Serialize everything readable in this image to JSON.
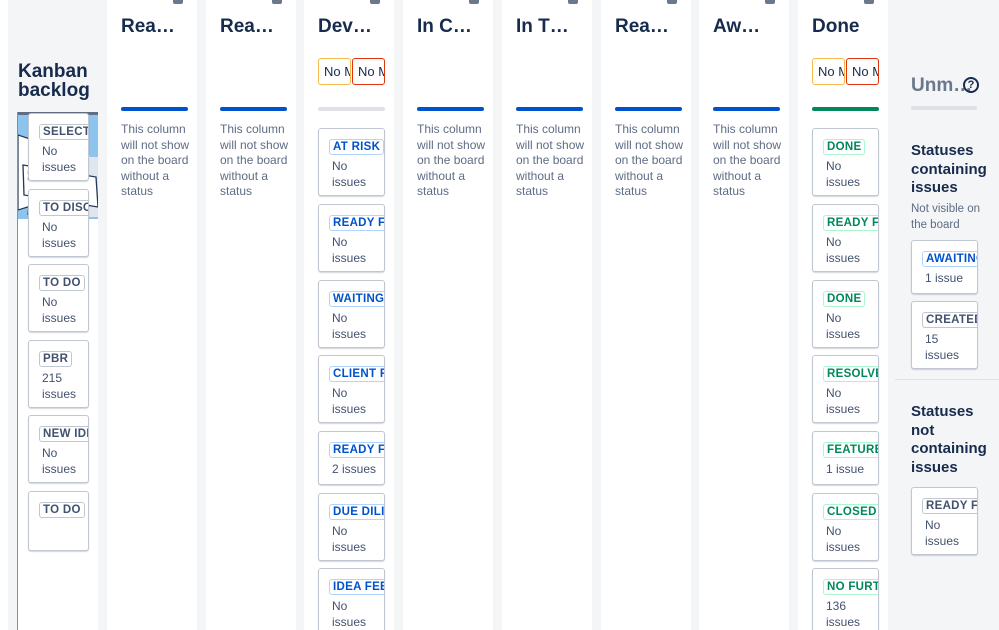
{
  "backlog": {
    "title": "Kanban backlog",
    "cards": [
      {
        "status": "SELECTED FOR DEVELOPMENT",
        "count": "No issues"
      },
      {
        "status": "TO DISCUSS",
        "count": "No issues"
      },
      {
        "status": "TO DO",
        "count": "No issues"
      },
      {
        "status": "PBR",
        "count": "215 issues"
      },
      {
        "status": "NEW IDEA",
        "count": "No issues"
      },
      {
        "status": "TO DO",
        "count": ""
      }
    ]
  },
  "no_status_text": "This column will not show on the board without a status",
  "columns": [
    {
      "title": "Rea…"
    },
    {
      "title": "Rea…"
    },
    {
      "title": "Dev…",
      "min_label": "No Min",
      "max_label": "No Max",
      "cards": [
        {
          "status": "AT RISK",
          "count": "No issues"
        },
        {
          "status": "READY FOR DEV",
          "count": "No issues"
        },
        {
          "status": "WAITING",
          "count": "No issues"
        },
        {
          "status": "CLIENT REVIEW",
          "count": "No issues"
        },
        {
          "status": "READY FOR QA",
          "count": "2 issues"
        },
        {
          "status": "DUE DILIGENCE",
          "count": "No issues"
        },
        {
          "status": "IDEA FEEDBACK",
          "count": "No issues"
        }
      ]
    },
    {
      "title": "In C…"
    },
    {
      "title": "In T…"
    },
    {
      "title": "Rea…"
    },
    {
      "title": "Aw…"
    },
    {
      "title": "Done",
      "min_label": "No Min",
      "max_label": "No Max",
      "cards": [
        {
          "status": "DONE",
          "count": "No issues"
        },
        {
          "status": "READY FOR RELEASE",
          "count": "No issues"
        },
        {
          "status": "DONE",
          "count": "No issues"
        },
        {
          "status": "RESOLVED",
          "count": "No issues"
        },
        {
          "status": "FEATURE REQUEST",
          "count": "1 issue"
        },
        {
          "status": "CLOSED",
          "count": "No issues"
        },
        {
          "status": "NO FURTHER ACTION",
          "count": "136 issues"
        }
      ]
    }
  ],
  "unmapped": {
    "title": "Unm…",
    "containing_heading": "Statuses containing issues",
    "containing_sub": "Not visible on the board",
    "containing_cards": [
      {
        "status": "AWAITING",
        "count": "1 issue"
      },
      {
        "status": "CREATED",
        "count": "15 issues"
      }
    ],
    "not_containing_heading": "Statuses not containing issues",
    "not_containing_cards": [
      {
        "status": "READY FOR",
        "count": "No issues"
      }
    ]
  },
  "colors": {
    "todo_bar": "#dfe1e6",
    "inprogress_bar": "#0052cc",
    "done_bar": "#00875a"
  }
}
